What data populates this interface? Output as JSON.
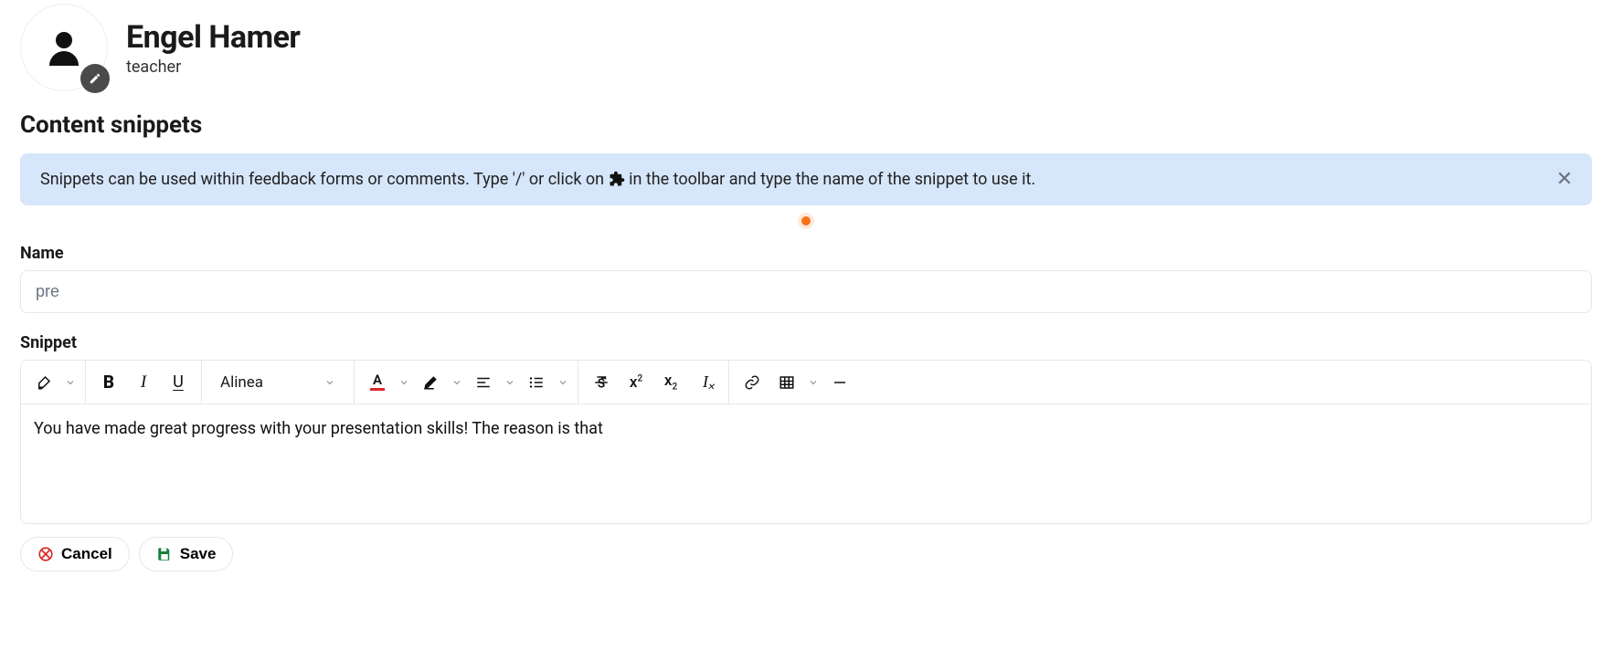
{
  "profile": {
    "name": "Engel Hamer",
    "role": "teacher"
  },
  "section_title": "Content snippets",
  "banner": {
    "text_before": "Snippets can be used within feedback forms or comments. Type '/' or click on ",
    "text_after": " in the toolbar and type the name of the snippet to use it."
  },
  "form": {
    "name_label": "Name",
    "name_value": "pre",
    "snippet_label": "Snippet",
    "snippet_content": "You have made great progress with your presentation skills! The reason is that"
  },
  "toolbar": {
    "block_format": "Alinea"
  },
  "actions": {
    "cancel": "Cancel",
    "save": "Save"
  }
}
